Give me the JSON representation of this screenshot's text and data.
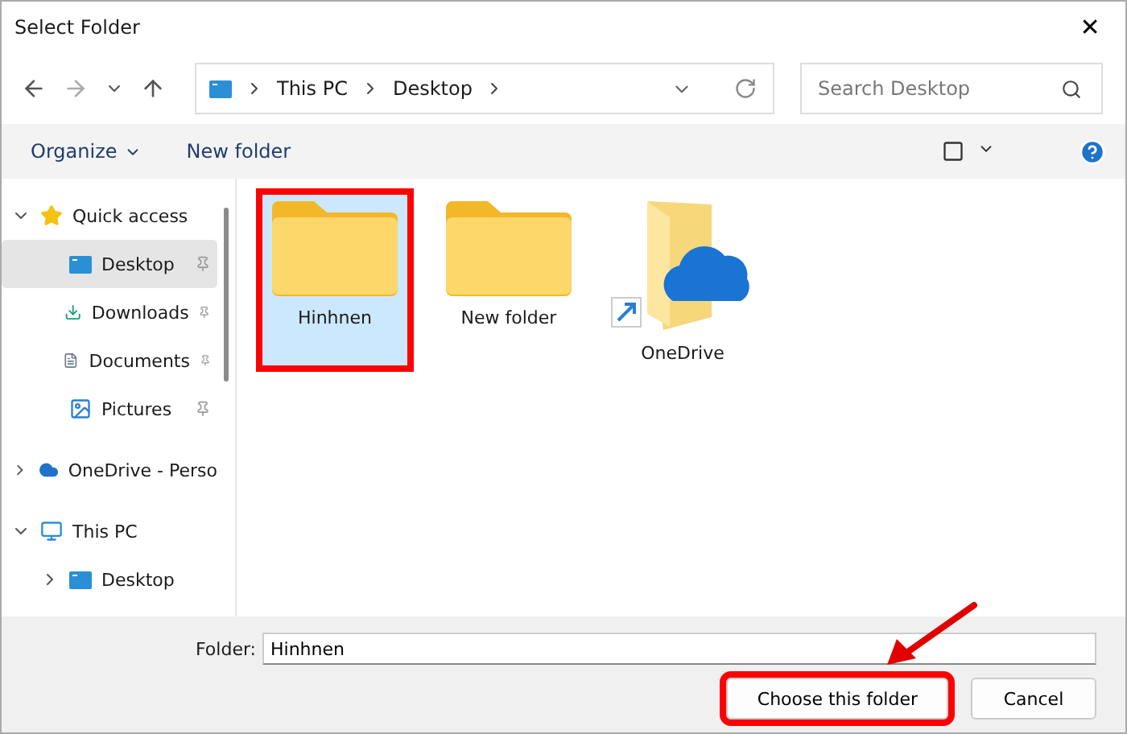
{
  "window": {
    "title": "Select Folder",
    "close": "✕"
  },
  "breadcrumb": [
    "This PC",
    "Desktop"
  ],
  "search": {
    "placeholder": "Search Desktop"
  },
  "commands": [
    "Organize",
    "New folder"
  ],
  "nav_tree": [
    {
      "label": "Quick access",
      "kind": "star",
      "expanded": true,
      "selected": false,
      "children": [
        {
          "label": "Desktop",
          "kind": "desktop",
          "selected": true,
          "pinned": true
        },
        {
          "label": "Downloads",
          "kind": "download",
          "selected": false,
          "pinned": true
        },
        {
          "label": "Documents",
          "kind": "document",
          "selected": false,
          "pinned": true
        },
        {
          "label": "Pictures",
          "kind": "picture",
          "selected": false,
          "pinned": true
        }
      ]
    },
    {
      "label": "OneDrive - Perso",
      "kind": "cloud",
      "expanded": false,
      "selected": false
    },
    {
      "label": "This PC",
      "kind": "monitor",
      "expanded": true,
      "selected": false,
      "children": [
        {
          "label": "Desktop",
          "kind": "desktop",
          "expanded": false,
          "selected": false,
          "pinned": false
        }
      ]
    }
  ],
  "items": [
    {
      "name": "Hinhnen",
      "kind": "folder",
      "selected": true,
      "highlighted": true
    },
    {
      "name": "New folder",
      "kind": "folder",
      "selected": false,
      "highlighted": false
    },
    {
      "name": "OneDrive",
      "kind": "shortcut",
      "selected": false,
      "highlighted": false
    }
  ],
  "folder_field": {
    "label": "Folder:",
    "value": "Hinhnen"
  },
  "buttons": [
    {
      "label": "Choose this folder",
      "highlighted": true
    },
    {
      "label": "Cancel",
      "highlighted": false
    }
  ],
  "callout_arrow": true
}
